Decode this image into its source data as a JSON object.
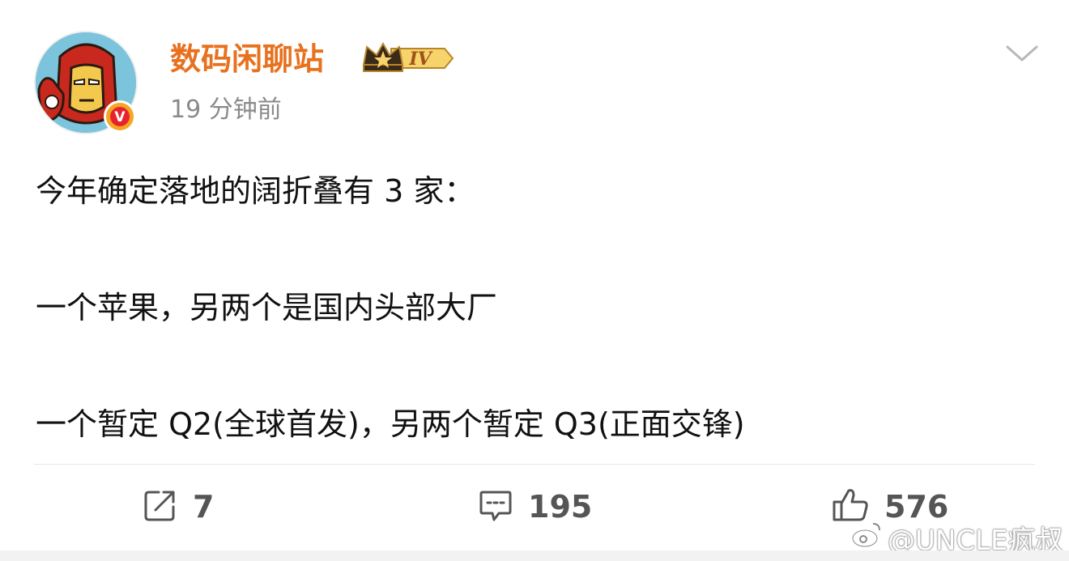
{
  "header": {
    "username": "数码闲聊站",
    "level_badge": "IV",
    "timestamp": "19 分钟前",
    "avatar_icon": "iron-man-avatar",
    "verify_badge": "V",
    "more_icon": "chevron-down-icon"
  },
  "post": {
    "line1": "今年确定落地的阔折叠有 3 家：",
    "line2": "一个苹果，另两个是国内头部大厂",
    "line3": "一个暂定 Q2(全球首发)，另两个暂定 Q3(正面交锋)"
  },
  "actions": {
    "repost_count": "7",
    "comment_count": "195",
    "like_count": "576"
  },
  "watermark": {
    "text": "@UNCLE疯叔"
  },
  "colors": {
    "username": "#e8711f",
    "timestamp": "#8a8a8a",
    "icon": "#555555",
    "badge": "#f5a623"
  }
}
